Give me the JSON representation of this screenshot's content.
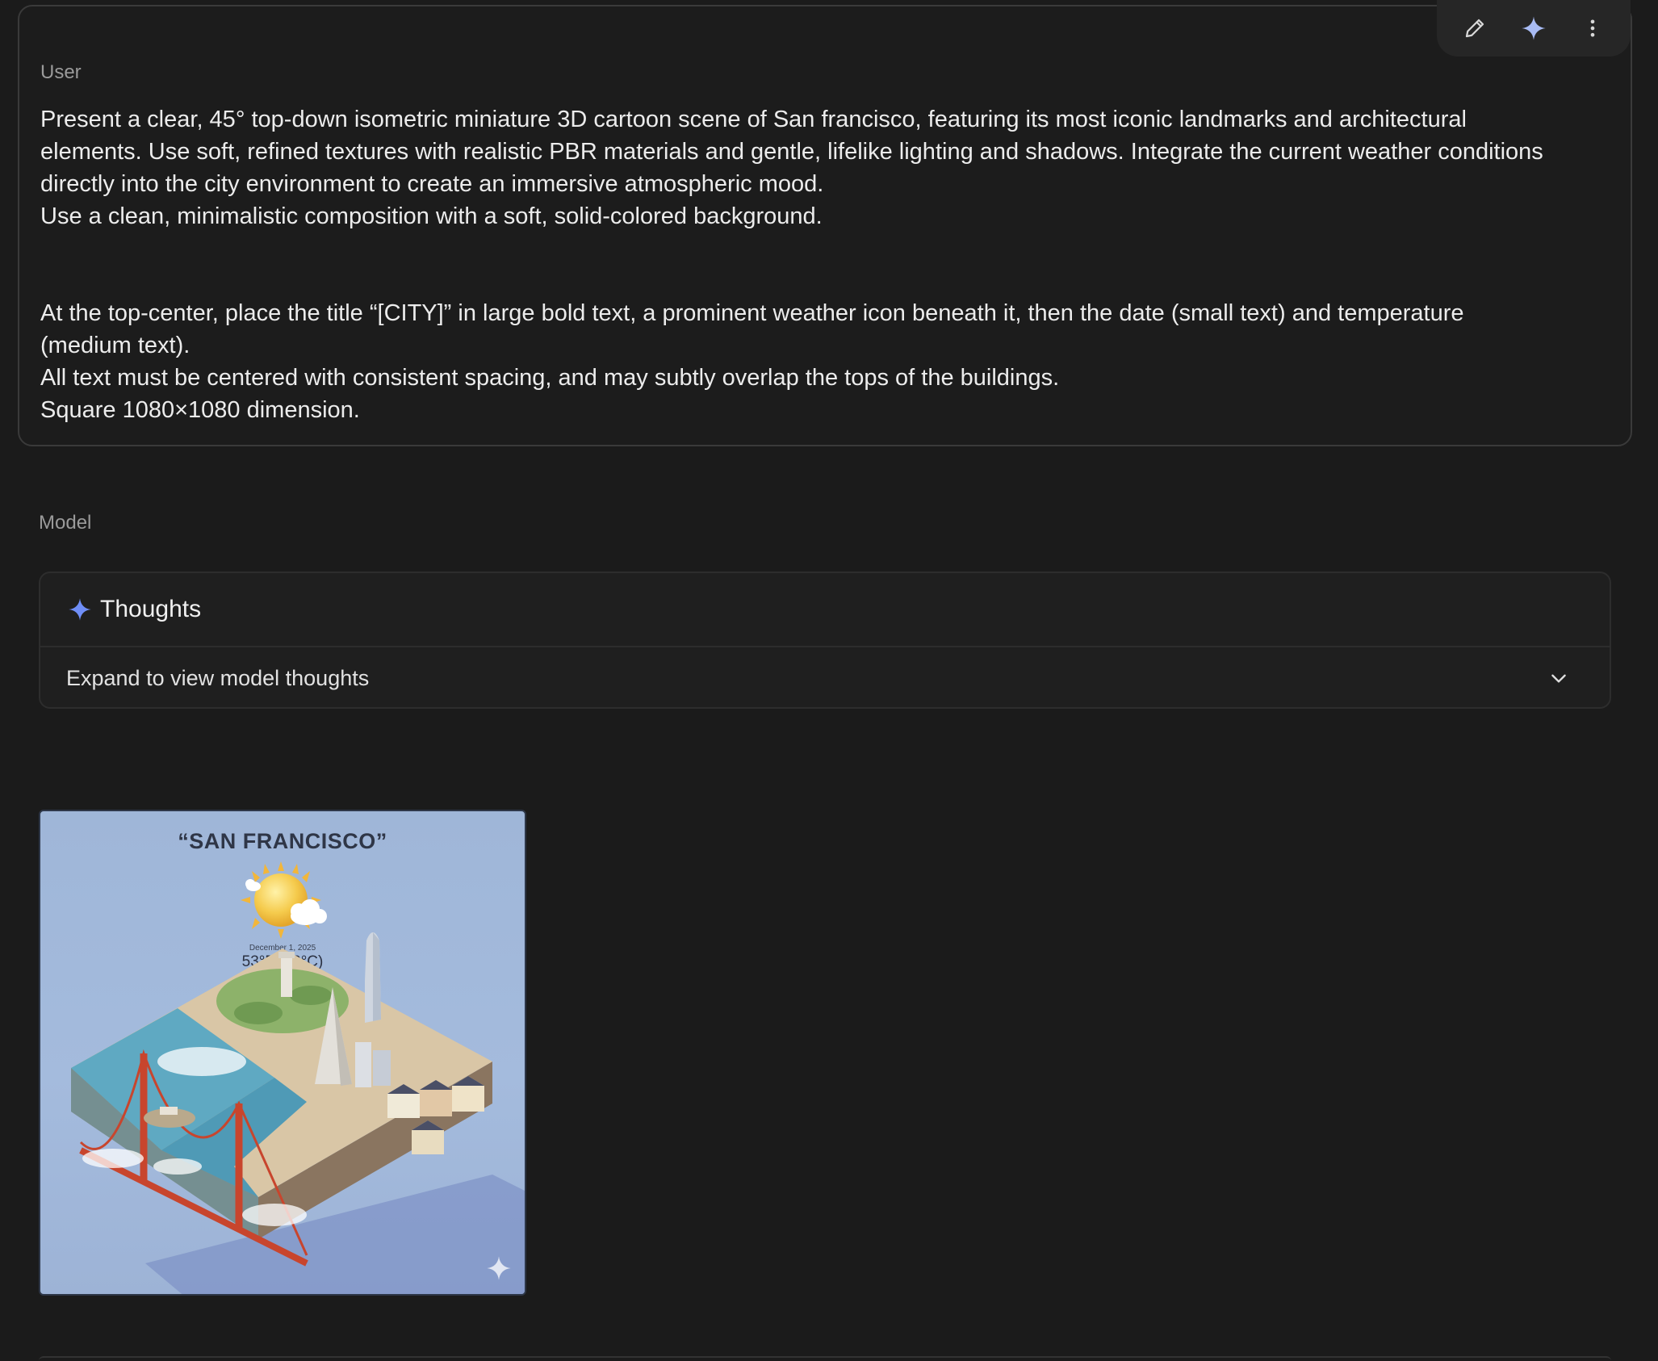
{
  "user_turn": {
    "role": "User",
    "prompt": "Present a clear, 45° top-down isometric miniature 3D cartoon scene of San francisco, featuring its most iconic landmarks and architectural\nelements. Use soft, refined textures with realistic PBR materials and gentle, lifelike lighting and shadows. Integrate the current weather conditions\ndirectly into the city environment to create an immersive atmospheric mood.\nUse a clean, minimalistic composition with a soft, solid-colored background.\n\n\nAt the top-center, place the title “[CITY]” in large bold text, a prominent weather icon beneath it, then the date (small text) and temperature\n(medium text).\nAll text must be centered with consistent spacing, and may subtly overlap the tops of the buildings.\nSquare 1080×1080 dimension.",
    "actions": [
      {
        "icon": "pencil-icon",
        "label": "Edit"
      },
      {
        "icon": "sparkle-icon",
        "label": "Rerun"
      },
      {
        "icon": "more-vert-icon",
        "label": "More options"
      }
    ]
  },
  "model_turn": {
    "role": "Model",
    "thoughts": {
      "title": "Thoughts",
      "expand_text": "Expand to view model thoughts",
      "icon": "sparkle-icon",
      "accent": "#6f8ef7"
    },
    "generated_image": {
      "title": "“SAN FRANCISCO”",
      "date": "December 1, 2025",
      "temperature": "53°F (12°C)",
      "weather_icon": "sun-partly-cloudy-icon",
      "watermark_icon": "sparkle-icon"
    }
  }
}
